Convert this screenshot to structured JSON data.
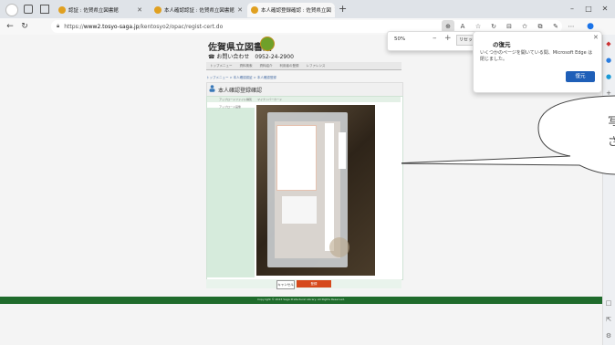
{
  "browser": {
    "tabs": [
      {
        "label": "",
        "active": false
      },
      {
        "label": "",
        "active": false
      },
      {
        "label": "認証 : 佐賀県立図書館",
        "active": false
      },
      {
        "label": "本人確認認証 : 佐賀県立図書館",
        "active": false
      },
      {
        "label": "本人確認登録確認 : 佐賀県立図",
        "active": true
      }
    ],
    "new_tab": "+",
    "window_controls": [
      "–",
      "□",
      "✕"
    ],
    "url_prefix": "https://",
    "url_host": "www2.tosyo-saga.jp",
    "url_path": "/kentosyo2/opac/regist-cert.do"
  },
  "zoom_popup": {
    "level": "50%",
    "minus": "–",
    "plus": "+",
    "reset": "リセット"
  },
  "restore_popup": {
    "title": "の復元",
    "body": "いくつかのページを開いている間、Microsoft Edge は閉じました。",
    "button": "復元",
    "close": "✕"
  },
  "page": {
    "logo": "佐賀県立図書館",
    "logo_sub": "Saga Prefectural Library",
    "phone": "☎ お問い合わせ　0952-24-2900",
    "nav": [
      "トップメニュー",
      "資料検索",
      "資料紹介",
      "利用者の登録",
      "レファレンス"
    ],
    "breadcrumb": "トップメニュー > 本人確認認証 > 本人確認登録",
    "section_title": "本人確認登録確認",
    "row_label_1": "アップロードファイル種別",
    "row_value_1": "マイナンバーカード",
    "row_label_2": "アップロード画像",
    "cancel": "キャンセル",
    "confirm": "登録",
    "copyright": "Copyright © 2023 Saga Prefectural Library. All Rights Reserved."
  },
  "callout": {
    "lines": [
      "写",
      "さ"
    ]
  }
}
